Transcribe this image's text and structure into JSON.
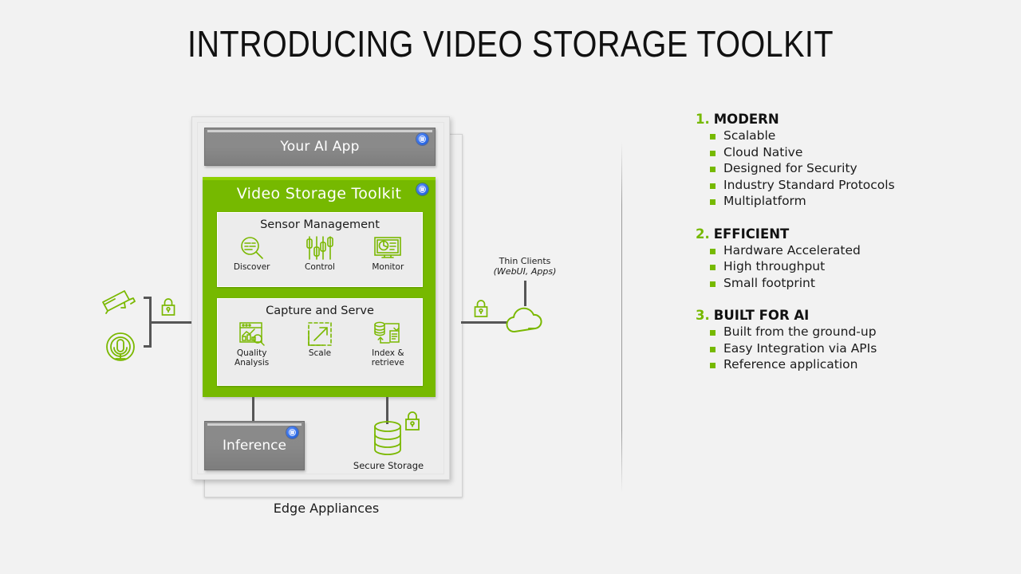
{
  "slide": {
    "title": "INTRODUCING VIDEO STORAGE TOOLKIT",
    "background_color": "#f2f2f2",
    "accent_green": "#76b900",
    "gray_box_color": "#898989",
    "badge_blue": "#2f6de8"
  },
  "diagram": {
    "edge_appliances_label": "Edge Appliances",
    "ai_app": {
      "label": "Your AI App",
      "badge_icon": "container-badge-icon"
    },
    "vst": {
      "title": "Video Storage Toolkit",
      "badge_icon": "container-badge-icon",
      "groups": [
        {
          "title": "Sensor Management",
          "items": [
            {
              "label": "Discover",
              "icon": "magnifier-discover-icon"
            },
            {
              "label": "Control",
              "icon": "sliders-control-icon"
            },
            {
              "label": "Monitor",
              "icon": "monitor-chart-icon"
            }
          ]
        },
        {
          "title": "Capture and Serve",
          "items": [
            {
              "label": "Quality\nAnalysis",
              "line1": "Quality",
              "line2": "Analysis",
              "icon": "chart-window-magnifier-icon"
            },
            {
              "label": "Scale",
              "line1": "Scale",
              "line2": "",
              "icon": "dashed-box-arrow-icon"
            },
            {
              "label": "Index &\nretrieve",
              "line1": "Index &",
              "line2": "retrieve",
              "icon": "database-document-icon"
            }
          ]
        }
      ]
    },
    "inference": {
      "label": "Inference",
      "badge_icon": "container-badge-icon"
    },
    "secure_storage": {
      "label": "Secure Storage",
      "icon": "database-icon",
      "lock_icon": "lock-icon"
    },
    "sensors": {
      "camera_icon": "cctv-camera-icon",
      "microphone_icon": "microphone-icon",
      "lock_icon": "lock-icon"
    },
    "thin_clients": {
      "line1": "Thin Clients",
      "line2": "(WebUI, Apps)",
      "cloud_icon": "cloud-icon",
      "lock_icon": "lock-icon"
    }
  },
  "features": [
    {
      "number": "1.",
      "heading": "MODERN",
      "bullets": [
        {
          "text": "Scalable"
        },
        {
          "text": "Cloud Native"
        },
        {
          "text": "Designed for Security"
        },
        {
          "text": "Industry Standard Protocols"
        },
        {
          "text": "Multiplatform"
        }
      ]
    },
    {
      "number": "2.",
      "heading": "EFFICIENT",
      "bullets": [
        {
          "text": "Hardware Accelerated"
        },
        {
          "text": "High throughput"
        },
        {
          "text": "Small footprint"
        }
      ]
    },
    {
      "number": "3.",
      "heading": "BUILT FOR AI",
      "bullets": [
        {
          "text": "Built from the ground-up"
        },
        {
          "text": "Easy Integration via APIs"
        },
        {
          "text": "Reference application"
        }
      ]
    }
  ]
}
